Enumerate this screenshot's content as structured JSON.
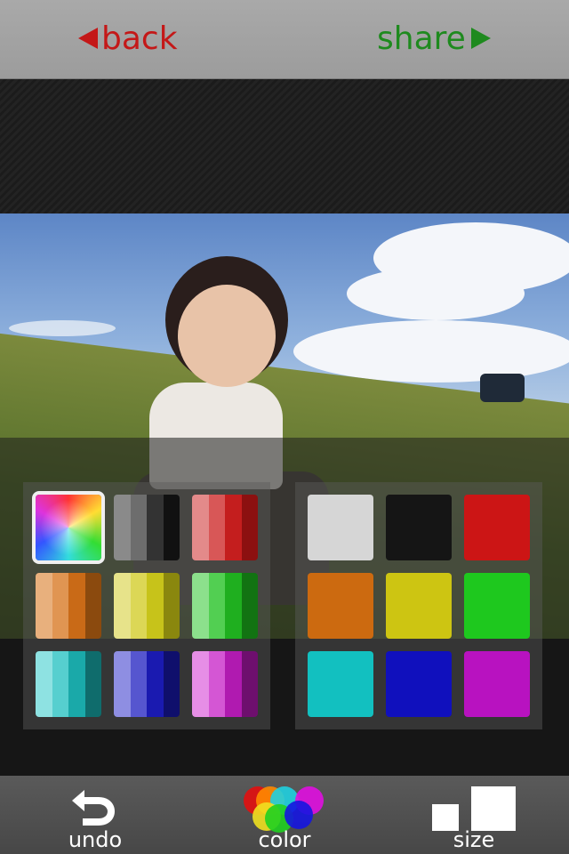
{
  "header": {
    "back_label": "back",
    "share_label": "share"
  },
  "palette": {
    "left_panel": [
      {
        "name": "rainbow"
      },
      {
        "name": "gray-shades",
        "stripes": [
          "#8a8a8a",
          "#6d6d6d",
          "#333333",
          "#111111"
        ]
      },
      {
        "name": "red-shades",
        "stripes": [
          "#e38a8a",
          "#d85757",
          "#c41e1e",
          "#8c1010"
        ]
      },
      {
        "name": "orange-shades",
        "stripes": [
          "#e8b07d",
          "#e09552",
          "#c96a17",
          "#8b4a0e"
        ]
      },
      {
        "name": "yellow-shades",
        "stripes": [
          "#e7e38a",
          "#dcd756",
          "#c7c31a",
          "#8a870e"
        ]
      },
      {
        "name": "green-shades",
        "stripes": [
          "#8ce08c",
          "#52cf52",
          "#1faf1f",
          "#127312"
        ]
      },
      {
        "name": "cyan-shades",
        "stripes": [
          "#8ee2e2",
          "#56cfcf",
          "#1aa9a9",
          "#0f6c6c"
        ]
      },
      {
        "name": "blue-shades",
        "stripes": [
          "#8e8ee2",
          "#5656cf",
          "#1a1ab0",
          "#0f0f6c"
        ]
      },
      {
        "name": "magenta-shades",
        "stripes": [
          "#e68ee6",
          "#d456d4",
          "#b01ab0",
          "#6e0f6e"
        ]
      }
    ],
    "right_panel": [
      {
        "name": "white",
        "color": "#d6d6d6"
      },
      {
        "name": "black",
        "color": "#151515"
      },
      {
        "name": "red",
        "color": "#cc1515"
      },
      {
        "name": "orange",
        "color": "#cc6a10"
      },
      {
        "name": "yellow",
        "color": "#cdc512"
      },
      {
        "name": "green",
        "color": "#1ec81e"
      },
      {
        "name": "cyan",
        "color": "#12c0c0"
      },
      {
        "name": "blue",
        "color": "#1010bd"
      },
      {
        "name": "magenta",
        "color": "#b812c0"
      }
    ]
  },
  "toolbar": {
    "undo_label": "undo",
    "color_label": "color",
    "size_label": "size"
  }
}
